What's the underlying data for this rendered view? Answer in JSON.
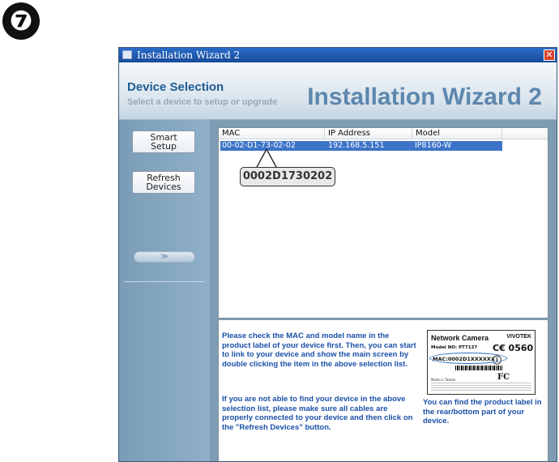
{
  "step_number": "❼",
  "window": {
    "title": "Installation Wizard 2",
    "close_symbol": "✕"
  },
  "header": {
    "title": "Device Selection",
    "subtitle": "Select a device to setup or upgrade",
    "brand": "Installation Wizard 2"
  },
  "sidebar": {
    "smart_setup_line1": "Smart",
    "smart_setup_line2": "Setup",
    "refresh_line1": "Refresh",
    "refresh_line2": "Devices",
    "expand_symbol": "≫"
  },
  "device_list": {
    "columns": [
      "MAC",
      "IP Address",
      "Model"
    ],
    "rows": [
      {
        "mac": "00-02-D1-73-02-02",
        "ip": "192.168.5.151",
        "model": "IP8160-W"
      }
    ],
    "callout": "0002D1730202"
  },
  "instructions": {
    "para1": "Please check the MAC and model name in the product label of your device first. Then, you can start to link to your device and show the main screen by double clicking the item in the above selection list.",
    "para2": "If you are not able to find your device in the above selection list, please make sure all cables are properly connected to your device and then click on the \"Refresh Devices\" button."
  },
  "product_label": {
    "title": "Network Camera",
    "brand": "VIVOTEK",
    "model": "Model NO: PT7137",
    "ce": "C€ 0560 ⓘ",
    "mac": "MAC:0002D1XXXXXX",
    "fc": "FC",
    "made_in": "Made in Taiwan",
    "caption": "You can find the product label in the rear/bottom part of your device."
  },
  "colors": {
    "accent": "#1a4fa8",
    "selection": "#3d74c7",
    "title_bar": "#1f58ad"
  }
}
